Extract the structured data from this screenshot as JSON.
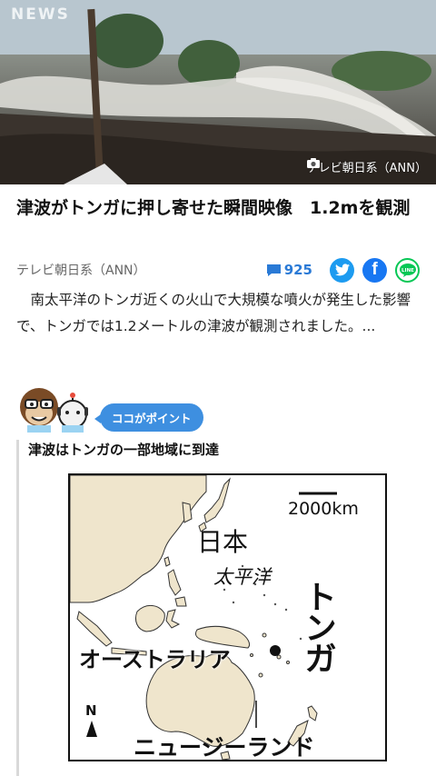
{
  "hero": {
    "logo": "NEWS",
    "credit": "テレビ朝日系（ANN）"
  },
  "article": {
    "headline": "津波がトンガに押し寄せた瞬間映像　1.2mを観測",
    "source": "テレビ朝日系（ANN）",
    "comment_count": "925",
    "summary": "南太平洋のトンガ近くの火山で大規模な噴火が発生した影響で、トンガでは1.2メートルの津波が観測されました。..."
  },
  "point": {
    "badge": "ココがポイント",
    "subheading": "津波はトンガの一部地域に到達"
  },
  "map": {
    "scale": "2000km",
    "japan": "日本",
    "pacific": "太平洋",
    "tonga": "トンガ",
    "australia": "オーストラリア",
    "north": "N",
    "new_zealand": "ニュージーランド"
  },
  "icons": {
    "camera": "camera-icon",
    "comment": "comment-icon",
    "twitter": "twitter-icon",
    "facebook": "facebook-icon",
    "line": "line-icon"
  },
  "colors": {
    "accent": "#3e8fe0",
    "comment": "#2a7ad6",
    "twitter": "#1d9bf0",
    "facebook": "#1877f2",
    "line": "#06c755"
  }
}
